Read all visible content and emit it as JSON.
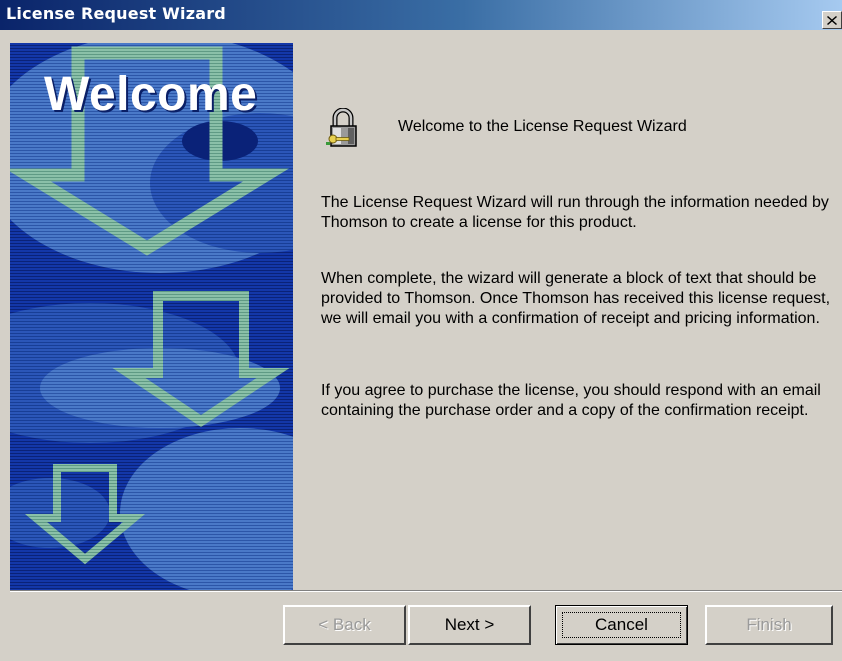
{
  "window": {
    "title": "License Request Wizard",
    "close_label": "×"
  },
  "side_panel": {
    "welcome_text": "Welcome"
  },
  "content": {
    "icon": "lock-key-icon",
    "heading": "Welcome to the License Request Wizard",
    "paragraphs": [
      "The License Request Wizard will run through the information needed by Thomson to create a license for this product.",
      "When complete, the wizard will generate a block of text that should be provided to Thomson. Once Thomson has received this license request, we will email you with a confirmation of receipt and pricing information.",
      "If you agree to purchase the license, you should respond with an email containing the purchase order and a copy of the confirmation receipt."
    ]
  },
  "buttons": {
    "back": {
      "label": "< Back",
      "enabled": false
    },
    "next": {
      "label": "Next >",
      "enabled": true
    },
    "cancel": {
      "label": "Cancel",
      "enabled": true,
      "focused": true
    },
    "finish": {
      "label": "Finish",
      "enabled": false
    }
  },
  "colors": {
    "titlebar_start": "#0a246a",
    "titlebar_end": "#a6caf0",
    "panel_blue": "#0a2a8c",
    "arrow_green": "#7fb8a0",
    "window_face": "#d4d0c8"
  }
}
